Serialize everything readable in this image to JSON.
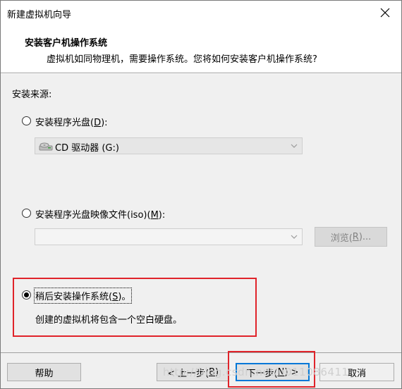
{
  "window": {
    "title": "新建虚拟机向导"
  },
  "header": {
    "title": "安装客户机操作系统",
    "subtitle": "虚拟机如同物理机，需要操作系统。您将如何安装客户机操作系统?"
  },
  "install_source": {
    "label": "安装来源:",
    "options": [
      {
        "label_prefix": "安装程序光盘(",
        "mnemonic": "D",
        "label_suffix": "):",
        "selected": false
      },
      {
        "label_prefix": "安装程序光盘映像文件(iso)(",
        "mnemonic": "M",
        "label_suffix": "):",
        "selected": false
      },
      {
        "label_prefix": "稍后安装操作系统(",
        "mnemonic": "S",
        "label_suffix": ")。",
        "selected": true,
        "description": "创建的虚拟机将包含一个空白硬盘。"
      }
    ],
    "disc_drive": {
      "value": "CD 驱动器 (G:)",
      "icon": "cd-drive-icon"
    },
    "iso_path": {
      "value": ""
    },
    "browse": {
      "prefix": "浏览(",
      "mnemonic": "R",
      "suffix": ")..."
    }
  },
  "footer": {
    "help": "帮助",
    "back": {
      "prefix": "< 上一步(",
      "mnemonic": "B",
      "suffix": ")"
    },
    "next": {
      "prefix": "下一步(",
      "mnemonic": "N",
      "suffix": ") >"
    },
    "cancel": "取消"
  },
  "watermark": "http://blog.csdn.net/u011086411",
  "colors": {
    "highlight": "#e0232a",
    "panel": "#f0f0f0",
    "disabled_text": "#838383"
  }
}
